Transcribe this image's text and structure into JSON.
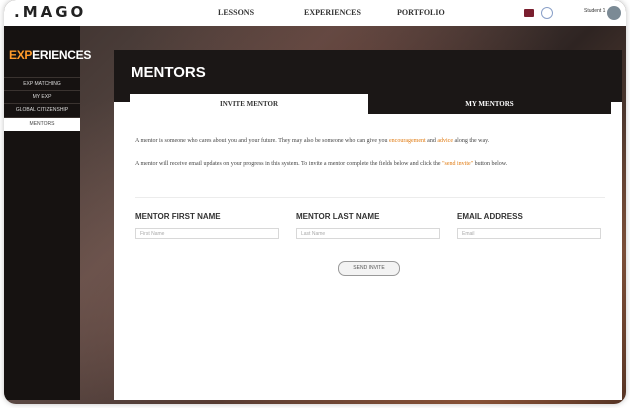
{
  "header": {
    "logo": "MAGO",
    "nav": [
      "LESSONS",
      "EXPERIENCES",
      "PORTFOLIO"
    ],
    "user_label": "Student 1"
  },
  "sidebar": {
    "title_accent": "EXP",
    "title_rest": "ERIENCES",
    "items": [
      {
        "label": "EXP MATCHING"
      },
      {
        "label": "MY EXP"
      },
      {
        "label": "GLOBAL CITIZENSHIP"
      },
      {
        "label": "MENTORS"
      }
    ]
  },
  "panel": {
    "title": "MENTORS",
    "tabs": [
      {
        "label": "INVITE MENTOR",
        "active": true
      },
      {
        "label": "MY MENTORS",
        "active": false
      }
    ],
    "desc1_a": "A mentor is someone who cares about you and your future. They may also be someone who can give you ",
    "desc1_hl1": "encouragement",
    "desc1_b": " and ",
    "desc1_hl2": "advice",
    "desc1_c": " along the way.",
    "desc2_a": "A mentor will receive email updates on your progress in this system. To invite a mentor complete the fields below and click the ",
    "desc2_hl": "\"send invite\"",
    "desc2_b": " button below.",
    "fields": [
      {
        "label": "MENTOR FIRST NAME",
        "placeholder": "First Name"
      },
      {
        "label": "MENTOR LAST NAME",
        "placeholder": "Last Name"
      },
      {
        "label": "EMAIL ADDRESS",
        "placeholder": "Email"
      }
    ],
    "send_label": "SEND INVITE"
  },
  "colors": {
    "accent": "#ff9a2a",
    "dark": "#1b1716"
  }
}
